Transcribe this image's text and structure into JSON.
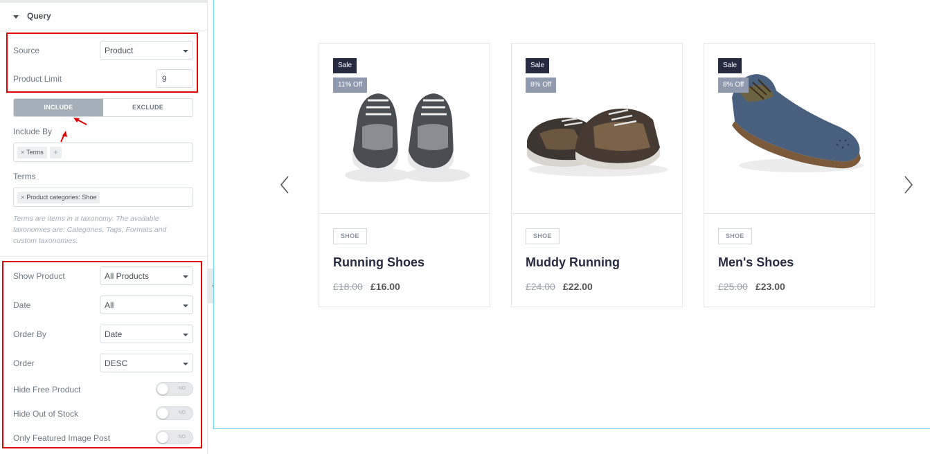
{
  "panel": {
    "section_title": "Query",
    "source": {
      "label": "Source",
      "value": "Product"
    },
    "product_limit": {
      "label": "Product Limit",
      "value": "9"
    },
    "tabs": {
      "include": "INCLUDE",
      "exclude": "EXCLUDE",
      "active": "include"
    },
    "include_by": {
      "label": "Include By",
      "chips": [
        "Terms"
      ]
    },
    "terms": {
      "label": "Terms",
      "chips": [
        "Product categories: Shoe"
      ]
    },
    "terms_description": "Terms are items in a taxonomy. The available taxonomies are: Categories, Tags, Formats and custom taxonomies.",
    "show_product": {
      "label": "Show Product",
      "value": "All Products"
    },
    "date": {
      "label": "Date",
      "value": "All"
    },
    "order_by": {
      "label": "Order By",
      "value": "Date"
    },
    "order": {
      "label": "Order",
      "value": "DESC"
    },
    "hide_free_product": {
      "label": "Hide Free Product",
      "state": "NO"
    },
    "hide_out_of_stock": {
      "label": "Hide Out of Stock",
      "state": "NO"
    },
    "only_featured_image_post": {
      "label": "Only Featured Image Post",
      "state": "NO"
    }
  },
  "products": [
    {
      "badge_sale": "Sale",
      "badge_discount": "11% Off",
      "category": "SHOE",
      "title": "Running Shoes",
      "price_old": "£18.00",
      "price_new": "£16.00",
      "image": "running-shoes"
    },
    {
      "badge_sale": "Sale",
      "badge_discount": "8% Off",
      "category": "SHOE",
      "title": "Muddy Running",
      "price_old": "£24.00",
      "price_new": "£22.00",
      "image": "muddy-running-shoes"
    },
    {
      "badge_sale": "Sale",
      "badge_discount": "8% Off",
      "category": "SHOE",
      "title": "Men's Shoes",
      "price_old": "£25.00",
      "price_new": "£23.00",
      "image": "mens-oxford-shoe"
    }
  ],
  "colors": {
    "highlight": "#e00000",
    "preview_border": "#71d7f7",
    "sale_badge": "#272b41",
    "discount_badge": "#8f9aaf",
    "active_tab": "#a4afb7"
  },
  "icons": [
    "collapse-arrow-icon",
    "caret-down-icon",
    "chevron-left-icon",
    "chevron-right-icon",
    "remove-chip-icon",
    "add-chip-icon",
    "red-arrow-icon"
  ]
}
